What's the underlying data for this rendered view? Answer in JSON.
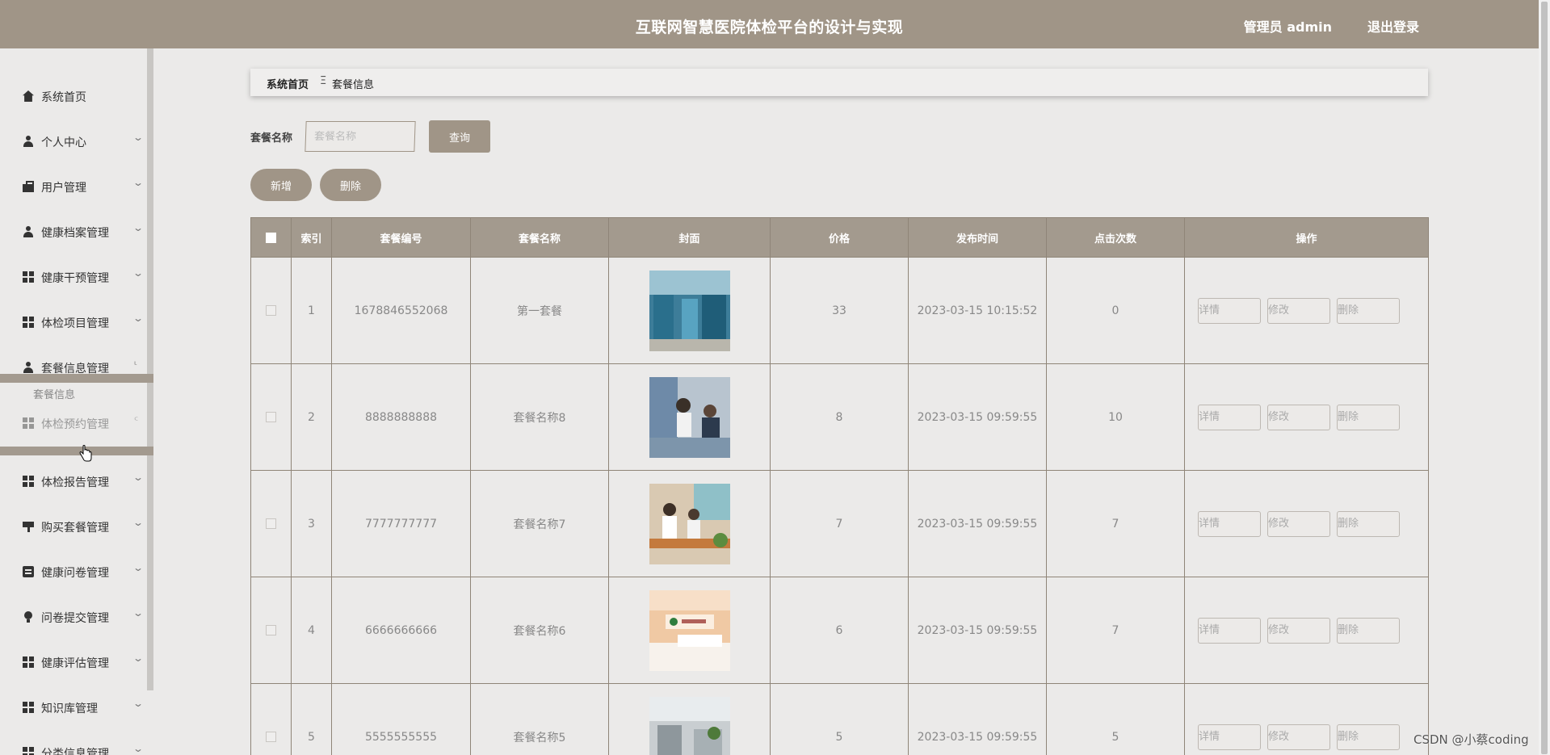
{
  "header": {
    "title": "互联网智慧医院体检平台的设计与实现",
    "user_label": "管理员 admin",
    "logout_label": "退出登录"
  },
  "sidebar": {
    "items": [
      {
        "label": "系统首页",
        "icon": "home-icon"
      },
      {
        "label": "个人中心",
        "icon": "person-icon"
      },
      {
        "label": "用户管理",
        "icon": "briefcase-icon"
      },
      {
        "label": "健康档案管理",
        "icon": "person-icon"
      },
      {
        "label": "健康干预管理",
        "icon": "grid-icon"
      },
      {
        "label": "体检项目管理",
        "icon": "grid-icon"
      },
      {
        "label": "套餐信息管理",
        "icon": "person-icon"
      },
      {
        "label": "体检预约管理",
        "icon": "grid-icon"
      },
      {
        "label": "体检报告管理",
        "icon": "grid-icon"
      },
      {
        "label": "购买套餐管理",
        "icon": "signpost-icon"
      },
      {
        "label": "健康问卷管理",
        "icon": "clipboard-icon"
      },
      {
        "label": "问卷提交管理",
        "icon": "bulb-icon"
      },
      {
        "label": "健康评估管理",
        "icon": "grid-icon"
      },
      {
        "label": "知识库管理",
        "icon": "grid-icon"
      },
      {
        "label": "分类信息管理",
        "icon": "grid-icon"
      }
    ],
    "submenu": {
      "label": "套餐信息"
    }
  },
  "breadcrumb": {
    "home": "系统首页",
    "separator": "Ξ",
    "current": "套餐信息"
  },
  "search": {
    "label": "套餐名称",
    "placeholder": "套餐名称",
    "query_label": "查询"
  },
  "actions": {
    "add_label": "新增",
    "delete_label": "删除"
  },
  "table": {
    "headers": [
      "索引",
      "套餐编号",
      "套餐名称",
      "封面",
      "价格",
      "发布时间",
      "点击次数",
      "操作"
    ],
    "rows": [
      {
        "index": "1",
        "code": "1678846552068",
        "name": "第一套餐",
        "price": "33",
        "time": "2023-03-15 10:15:52",
        "clicks": "0"
      },
      {
        "index": "2",
        "code": "8888888888",
        "name": "套餐名称8",
        "price": "8",
        "time": "2023-03-15 09:59:55",
        "clicks": "10"
      },
      {
        "index": "3",
        "code": "7777777777",
        "name": "套餐名称7",
        "price": "7",
        "time": "2023-03-15 09:59:55",
        "clicks": "7"
      },
      {
        "index": "4",
        "code": "6666666666",
        "name": "套餐名称6",
        "price": "6",
        "time": "2023-03-15 09:59:55",
        "clicks": "7"
      },
      {
        "index": "5",
        "code": "5555555555",
        "name": "套餐名称5",
        "price": "5",
        "time": "2023-03-15 09:59:55",
        "clicks": "5"
      }
    ],
    "row_actions": {
      "detail": "详情",
      "edit": "修改",
      "delete": "删除"
    }
  },
  "watermark": "CSDN @小蔡coding",
  "colors": {
    "accent": "#a09587",
    "background": "#ebeae9",
    "header_text": "#ffffff"
  }
}
